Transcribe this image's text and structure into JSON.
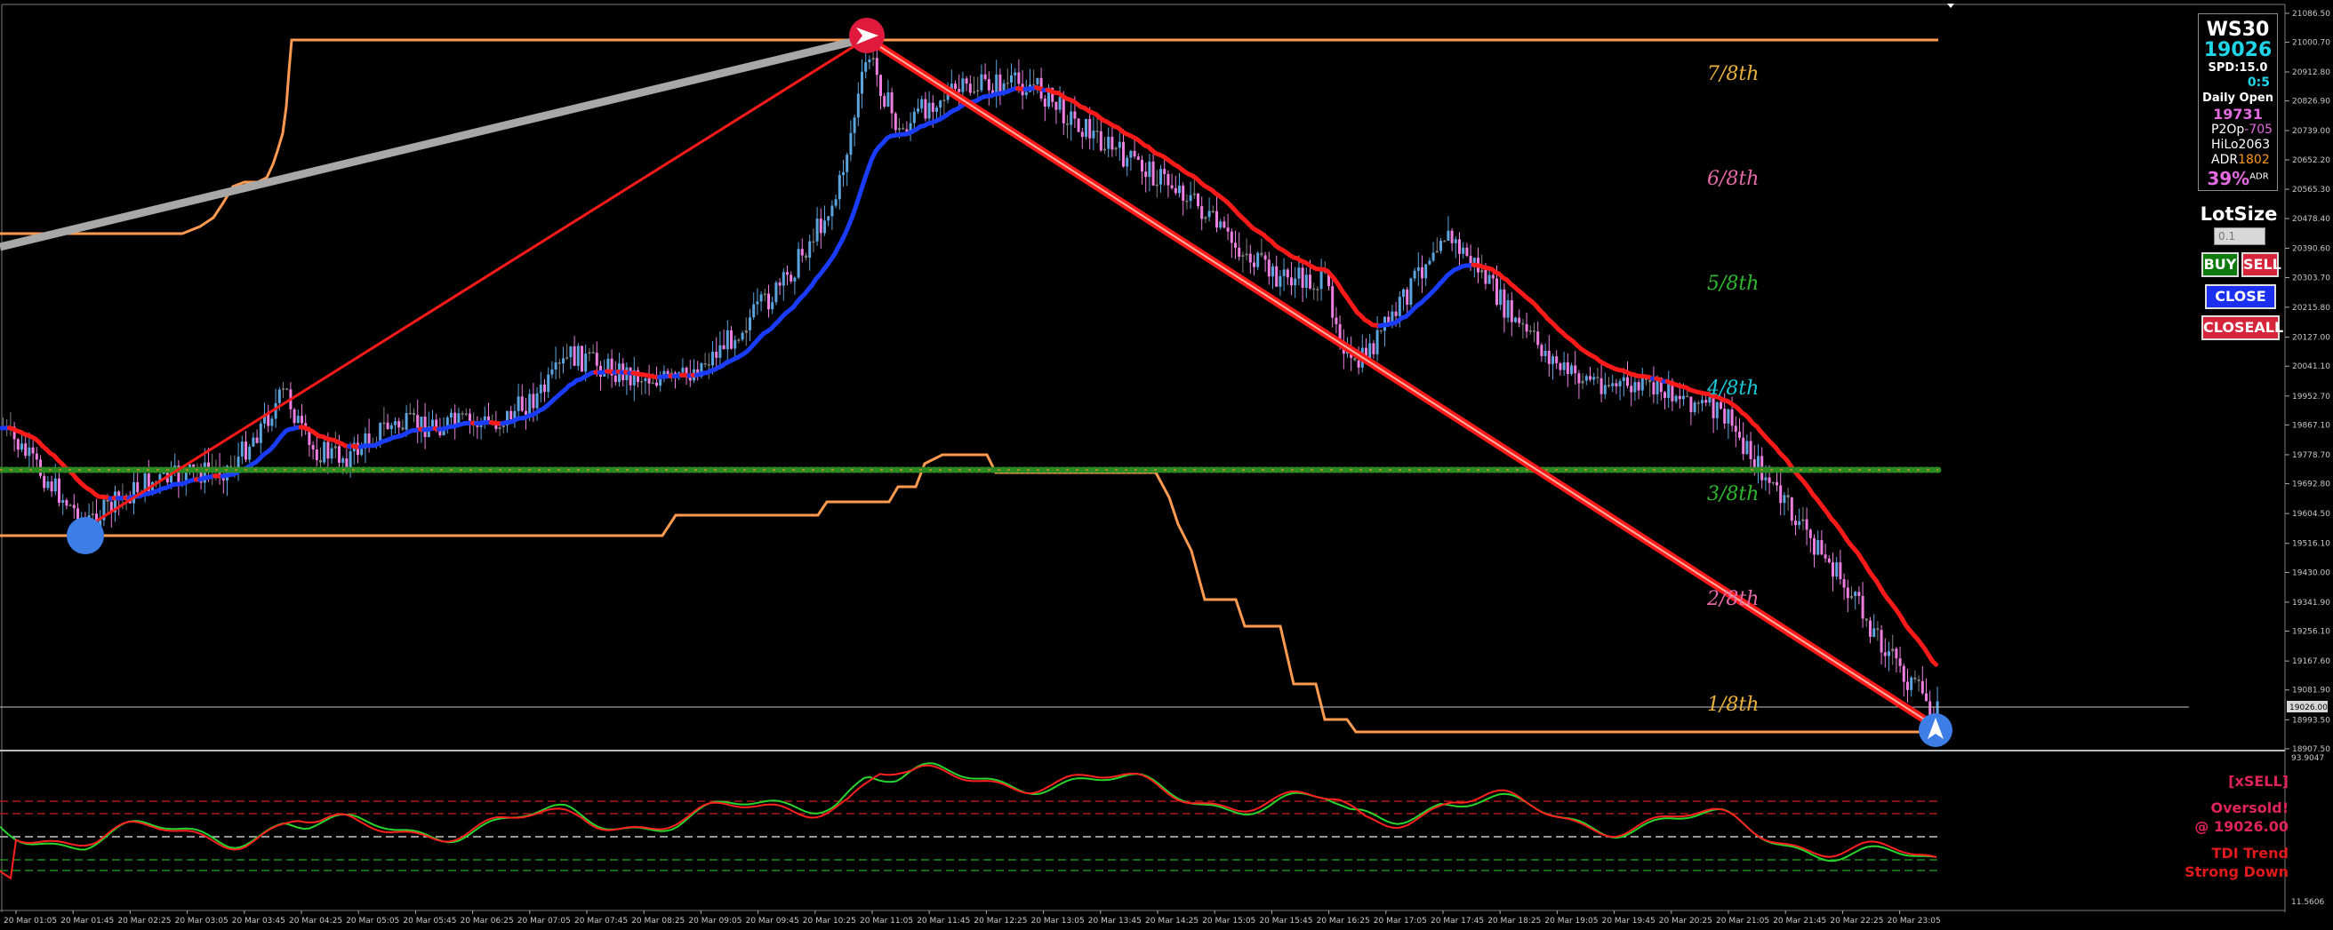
{
  "symbol": "WS30",
  "panel": {
    "price": "19026",
    "spread": "SPD:15.0",
    "timer": "0:5",
    "daily_open_label": "Daily Open",
    "daily_open_value": "19731",
    "p2op_label": "P2Op",
    "p2op_value": "-705",
    "hilo_label": "HiLo",
    "hilo_value": "2063",
    "adr_label": "ADR",
    "adr_value": "1802",
    "adr_pct": "39%",
    "adr_pct_suffix": "ADR"
  },
  "trade": {
    "lotsize_label": "LotSize",
    "lotsize_placeholder": "0.1",
    "buy_label": "BUY",
    "sell_label": "SELL",
    "close_label": "CLOSE",
    "closeall_label": "CLOSEALL"
  },
  "alerts": {
    "signal": "[xSELL]",
    "oversold": "Oversold!",
    "oversold_price": "@ 19026.00",
    "trend_line1": "TDI Trend",
    "trend_line2": "Strong Down"
  },
  "murrey_levels": [
    {
      "label": "7/8th",
      "price": 20912,
      "color": "#e8b13c"
    },
    {
      "label": "6/8th",
      "price": 20560,
      "color": "#e36aa6"
    },
    {
      "label": "5/8th",
      "price": 20208,
      "color": "#2fb82f"
    },
    {
      "label": "4/8th",
      "price": 19856,
      "color": "#17c9d6"
    },
    {
      "label": "3/8th",
      "price": 19504,
      "color": "#2fb82f"
    },
    {
      "label": "2/8th",
      "price": 19152,
      "color": "#e36aa6"
    },
    {
      "label": "1/8th",
      "price": 18800,
      "color": "#e8b13c"
    }
  ],
  "price_axis": {
    "ticks": [
      "21086.50",
      "21000.70",
      "20912.80",
      "20826.90",
      "20739.00",
      "20652.20",
      "20565.30",
      "20478.40",
      "20390.60",
      "20303.70",
      "20215.80",
      "20127.00",
      "20041.10",
      "19952.70",
      "19867.10",
      "19778.70",
      "19692.80",
      "19604.50",
      "19516.10",
      "19430.00",
      "19341.90",
      "19256.10",
      "19167.60",
      "19081.90",
      "18993.50",
      "18907.50"
    ],
    "current_price_tag": "19026.00"
  },
  "indicator_axis": {
    "top": "93.9047",
    "bottom": "11.5606"
  },
  "time_axis": [
    "20 Mar 01:05",
    "20 Mar 01:45",
    "20 Mar 02:25",
    "20 Mar 03:05",
    "20 Mar 03:45",
    "20 Mar 04:25",
    "20 Mar 05:05",
    "20 Mar 05:45",
    "20 Mar 06:25",
    "20 Mar 07:05",
    "20 Mar 07:45",
    "20 Mar 08:25",
    "20 Mar 09:05",
    "20 Mar 09:45",
    "20 Mar 10:25",
    "20 Mar 11:05",
    "20 Mar 11:45",
    "20 Mar 12:25",
    "20 Mar 13:05",
    "20 Mar 13:45",
    "20 Mar 14:25",
    "20 Mar 15:05",
    "20 Mar 15:45",
    "20 Mar 16:25",
    "20 Mar 17:05",
    "20 Mar 17:45",
    "20 Mar 18:25",
    "20 Mar 19:05",
    "20 Mar 19:45",
    "20 Mar 20:25",
    "20 Mar 21:05",
    "20 Mar 21:45",
    "20 Mar 22:25",
    "20 Mar 23:05"
  ],
  "colors": {
    "background": "#000000",
    "bull_candle": "#5ba4de",
    "bear_candle": "#ee7fe0",
    "neutral_candle": "#808080",
    "ma_down": "#ff1a1a",
    "ma_up": "#1a3cff",
    "trend_line": "#ff1a1a",
    "hilo_line": "#ff9a50",
    "daily_open_line": "#2c8a22",
    "tdi_green": "#29d42c",
    "tdi_red": "#ff2020"
  }
}
